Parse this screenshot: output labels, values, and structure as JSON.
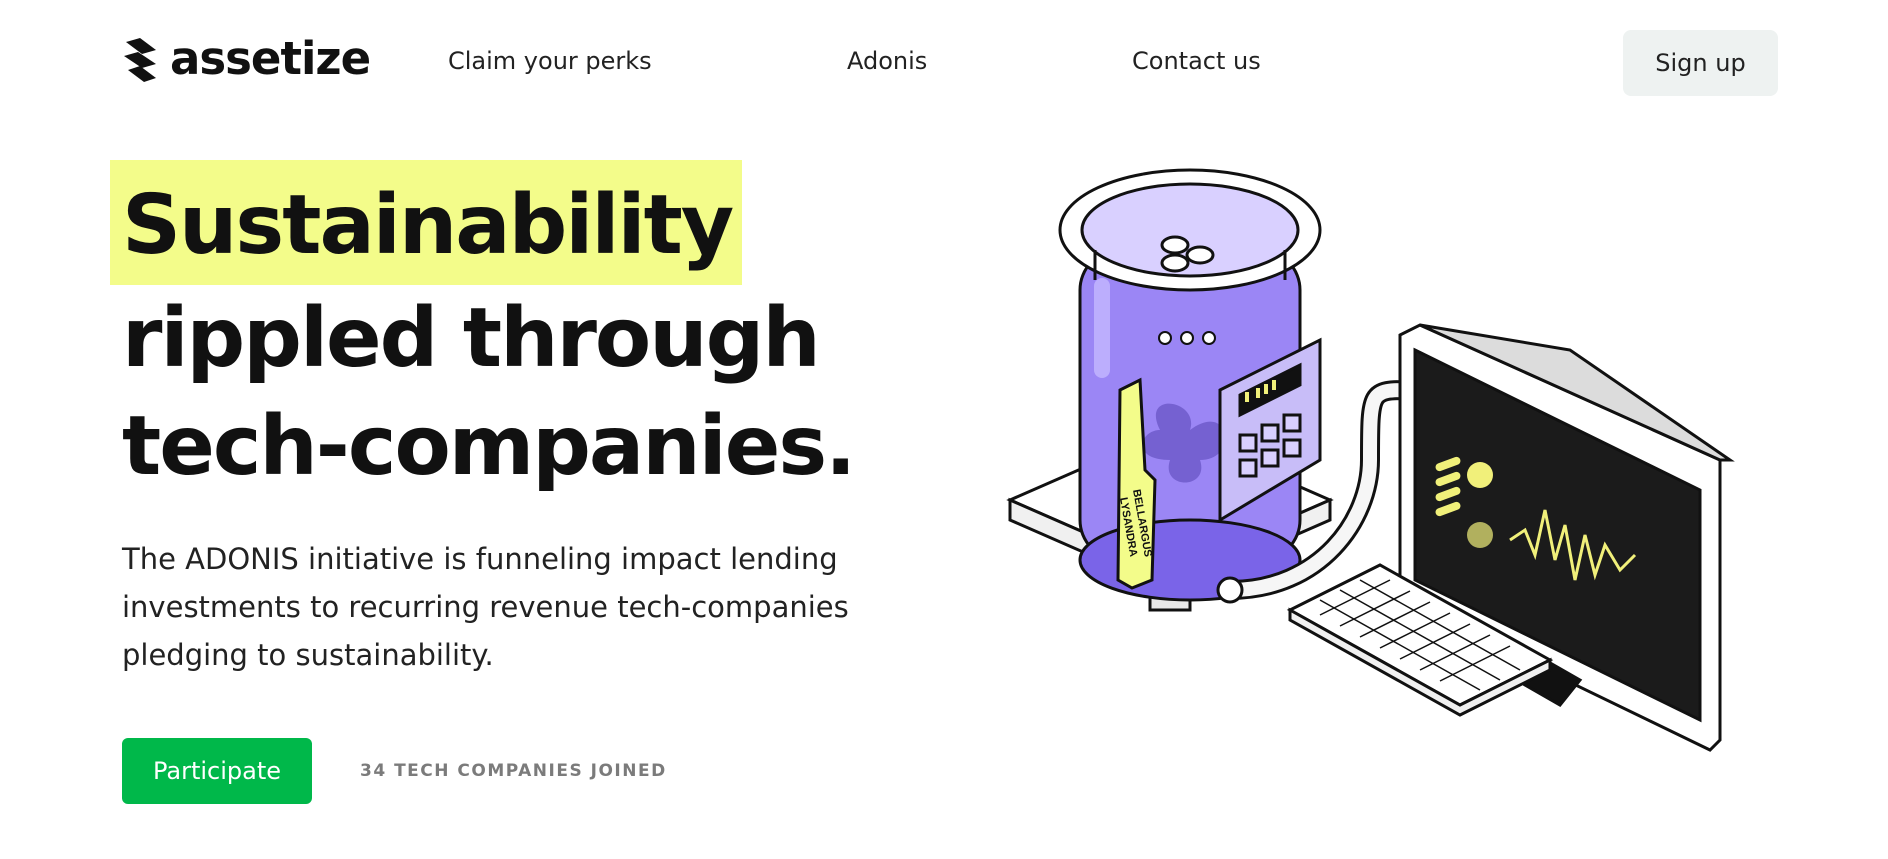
{
  "brand": {
    "name": "assetize"
  },
  "nav": {
    "links": [
      "Claim your perks",
      "Adonis",
      "Contact us"
    ],
    "signup_label": "Sign up"
  },
  "hero": {
    "highlight": "Sustainability",
    "line2": "rippled through",
    "line3": "tech-companies.",
    "description": "The ADONIS initiative is funneling impact lending investments to recurring revenue tech-companies pledging to sustainability.",
    "cta_label": "Participate",
    "joined_text": "34 TECH COMPANIES JOINED"
  },
  "illustration": {
    "label_line1": "BELLARGUS",
    "label_line2": "LYSANDRA"
  },
  "colors": {
    "accent_green": "#00b84a",
    "highlight_yellow": "#f3fc8a",
    "purple": "#9b86f5",
    "screen_line": "#f1f07a"
  }
}
